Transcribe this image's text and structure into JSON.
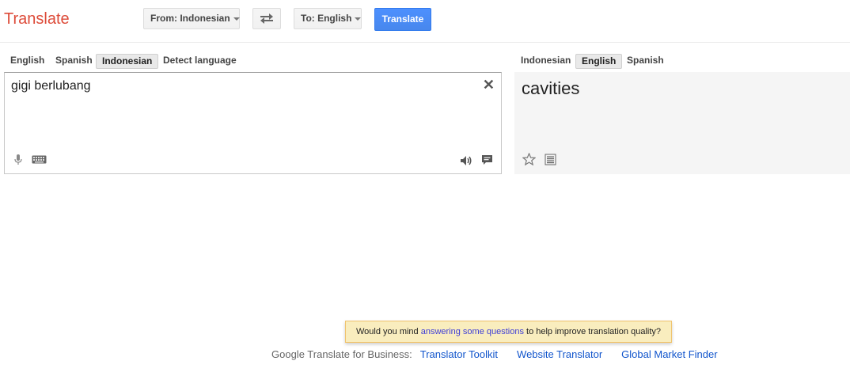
{
  "header": {
    "logo": "Translate",
    "from_label": "From: Indonesian",
    "to_label": "To: English",
    "translate_label": "Translate"
  },
  "source": {
    "tabs": [
      "English",
      "Spanish",
      "Indonesian",
      "Detect language"
    ],
    "selected_tab": "Indonesian",
    "text": "gigi berlubang"
  },
  "target": {
    "tabs": [
      "Indonesian",
      "English",
      "Spanish"
    ],
    "selected_tab": "English",
    "text": "cavities"
  },
  "feedback": {
    "prefix": "Would you mind ",
    "link": "answering some questions",
    "suffix": " to help improve translation quality?"
  },
  "footer": {
    "label": "Google Translate for Business:",
    "links": [
      "Translator Toolkit",
      "Website Translator",
      "Global Market Finder"
    ]
  },
  "colors": {
    "logo": "#dd4b39",
    "translate_button": "#4d90fe",
    "link": "#1155cc",
    "feedback_bg": "#f9edbe"
  },
  "icons": [
    "swap-arrows-icon",
    "close-icon",
    "microphone-icon",
    "keyboard-icon",
    "speaker-icon",
    "speech-bubble-icon",
    "star-icon",
    "document-list-icon"
  ]
}
